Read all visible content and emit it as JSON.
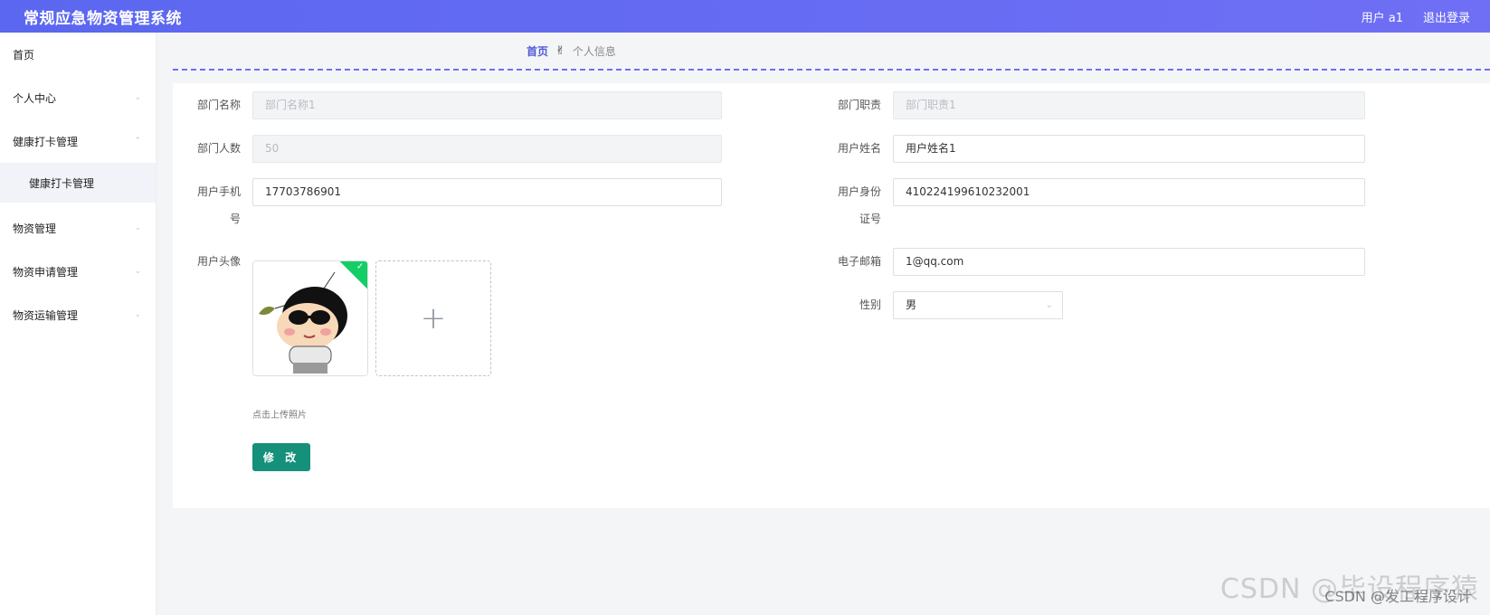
{
  "header": {
    "title": "常规应急物资管理系统",
    "user_label": "用户 a1",
    "logout_label": "退出登录"
  },
  "sidebar": {
    "items": [
      {
        "label": "首页"
      },
      {
        "label": "个人中心"
      },
      {
        "label": "健康打卡管理"
      },
      {
        "label": "健康打卡管理"
      },
      {
        "label": "物资管理"
      },
      {
        "label": "物资申请管理"
      },
      {
        "label": "物资运输管理"
      }
    ]
  },
  "breadcrumb": {
    "home": "首页",
    "separator": "✌",
    "current": "个人信息"
  },
  "form": {
    "dept_name": {
      "label": "部门名称",
      "value": "部门名称1"
    },
    "dept_duty": {
      "label": "部门职责",
      "value": "部门职责1"
    },
    "dept_count": {
      "label": "部门人数",
      "value": "50"
    },
    "user_name": {
      "label": "用户姓名",
      "value": "用户姓名1"
    },
    "phone": {
      "label1": "用户手机",
      "label2": "号",
      "value": "17703786901"
    },
    "id_card": {
      "label1": "用户身份",
      "label2": "证号",
      "value": "410224199610232001"
    },
    "avatar": {
      "label": "用户头像",
      "plus": "+",
      "hint": "点击上传照片"
    },
    "email": {
      "label": "电子邮箱",
      "value": "1@qq.com"
    },
    "gender": {
      "label": "性别",
      "value": "男"
    },
    "submit_label": "修 改"
  },
  "watermark": {
    "line1": "CSDN @毕设程序猿",
    "line2": "CSDN @发工程序设计"
  },
  "colors": {
    "header": "#5b67f0",
    "accent": "#6f6ff5",
    "button": "#15907a"
  }
}
